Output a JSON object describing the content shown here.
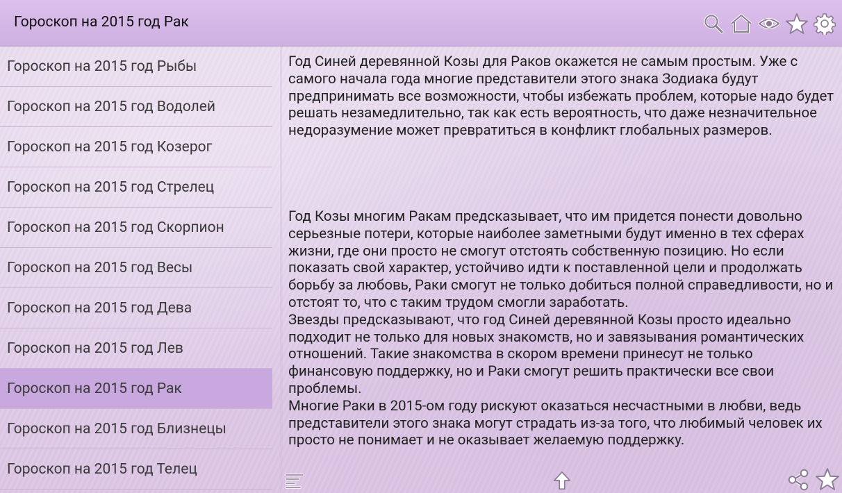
{
  "app": {
    "title": "Гороскоп на 2015 год Рак"
  },
  "toolbar": {
    "icons": [
      "search-icon",
      "home-icon",
      "eye-icon",
      "star-icon",
      "gear-icon"
    ]
  },
  "sidebar": {
    "items": [
      {
        "label": "Гороскоп на 2015 год Рыбы",
        "selected": false
      },
      {
        "label": "Гороскоп на 2015 год Водолей",
        "selected": false
      },
      {
        "label": "Гороскоп на 2015 год Козерог",
        "selected": false
      },
      {
        "label": "Гороскоп на 2015 год Стрелец",
        "selected": false
      },
      {
        "label": "Гороскоп на 2015 год Скорпион",
        "selected": false
      },
      {
        "label": "Гороскоп на 2015 год Весы",
        "selected": false
      },
      {
        "label": "Гороскоп на 2015 год Дева",
        "selected": false
      },
      {
        "label": "Гороскоп на 2015 год Лев",
        "selected": false
      },
      {
        "label": "Гороскоп на 2015 год Рак",
        "selected": true
      },
      {
        "label": "Гороскоп на 2015 год Близнецы",
        "selected": false
      },
      {
        "label": "Гороскоп на 2015 год Телец",
        "selected": false
      }
    ]
  },
  "article": {
    "paragraph1": "Год Синей деревянной Козы для Раков окажется не самым простым. Уже с самого начала года многие представители этого знака Зодиака будут предпринимать все возможности, чтобы избежать проблем, которые надо будет решать незамедлительно, так как есть вероятность, что даже незначительное недоразумение может превратиться в конфликт глобальных размеров.",
    "paragraph2": "Год Козы многим Ракам предсказывает, что им придется понести довольно серьезные потери, которые наиболее заметными будут именно в тех сферах жизни, где они просто не смогут отстоять собственную позицию. Но если показать свой характер, устойчиво идти к поставленной цели и продолжать борьбу за любовь, Раки смогут не только добиться полной справедливости, но и отстоят то, что с таким трудом смогли заработать.",
    "paragraph3": "Звезды предсказывают, что год Синей деревянной Козы просто идеально подходит не только для новых знакомств, но и завязывания романтических отношений. Такие знакомства в скором времени принесут не только финансовую поддержку, но и Раки смогут решить практически все свои проблемы.",
    "paragraph4": "Многие Раки в 2015-ом году рискуют оказаться несчастными в любви, ведь представители этого знака могут страдать из-за того, что любимый человек их просто не понимает и не оказывает желаемую поддержку."
  },
  "bottom_bar": {
    "icons": [
      "list-icon",
      "up-arrow-icon",
      "share-icon",
      "favorite-star-icon"
    ]
  },
  "colors": {
    "topbar": "#d4b6e6",
    "selected_item": "#c9a8e0",
    "background": "#e4d3ea"
  }
}
